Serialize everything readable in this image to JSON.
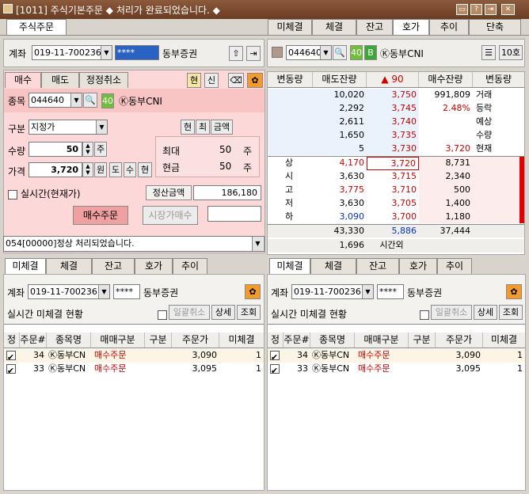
{
  "window": {
    "title": "[1011] 주식기본주문   ◆ 처리가 완료되었습니다. ◆"
  },
  "main_tabs": [
    "주식주문"
  ],
  "top_right_tabs": [
    "미체결",
    "체결",
    "잔고",
    "호가",
    "추이",
    "단축"
  ],
  "account": {
    "label": "계좌",
    "number": "019-11-700236",
    "password": "****",
    "broker": "동부증권"
  },
  "order": {
    "tabs": [
      "매수",
      "매도",
      "정정취소"
    ],
    "toggle_a": "현",
    "toggle_b": "신",
    "stock_label": "종목",
    "stock_code": "044640",
    "stock_badge": "40",
    "stock_name": "Ⓚ동부CNI",
    "type_label": "구분",
    "type_value": "지정가",
    "type_buttons": [
      "현",
      "최",
      "금액"
    ],
    "qty_label": "수량",
    "qty_value": "50",
    "qty_unit": "주",
    "price_label": "가격",
    "price_value": "3,720",
    "price_unit": "원",
    "price_buttons": [
      "도",
      "수",
      "현"
    ],
    "max_label": "최대",
    "max_value": "50",
    "max_unit": "주",
    "cur_label": "현금",
    "cur_value": "50",
    "cur_unit": "주",
    "realtime_label": "실시간(현재가)",
    "settle_label": "정산금액",
    "settle_value": "186,180",
    "buy_button": "매수주문",
    "market_buy_button": "시장가매수",
    "message": "054[00000]정상 처리되었습니다."
  },
  "quote": {
    "code": "044640",
    "badge1": "40",
    "badge2": "B",
    "name": "Ⓚ동부CNI",
    "ticks": "10호",
    "headers": [
      "변동량",
      "매도잔량",
      "▲  90",
      "매수잔량",
      "변동량"
    ],
    "ask_rows": [
      {
        "qty": "10,020",
        "price": "3,750",
        "bid": "991,809",
        "side": "거래"
      },
      {
        "qty": "2,292",
        "price": "3,745",
        "bid": "2.48%",
        "side": "등락"
      },
      {
        "qty": "2,611",
        "price": "3,740",
        "bid": "",
        "side": "예상"
      },
      {
        "qty": "1,650",
        "price": "3,735",
        "bid": "",
        "side": "수량"
      },
      {
        "qty": "5",
        "price": "3,730",
        "bid": "3,720",
        "side": "현재"
      }
    ],
    "bid_rows": [
      {
        "label": "상",
        "ask": "4,170",
        "price": "3,720",
        "bid": "8,731"
      },
      {
        "label": "시",
        "ask": "3,630",
        "price": "3,715",
        "bid": "2,340"
      },
      {
        "label": "고",
        "ask": "3,775",
        "price": "3,710",
        "bid": "500"
      },
      {
        "label": "저",
        "ask": "3,630",
        "price": "3,705",
        "bid": "1,400"
      },
      {
        "label": "하",
        "ask": "3,090",
        "price": "3,700",
        "bid": "1,180"
      }
    ],
    "total_ask": "43,330",
    "total_diff": "5,886",
    "total_bid": "37,444",
    "after_hours_qty": "1,696",
    "after_hours_label": "시간외"
  },
  "bottom_tabs": [
    "미체결",
    "체결",
    "잔고",
    "호가",
    "추이"
  ],
  "unfilled": {
    "title": "실시간 미체결 현황",
    "cancel_all": "일괄취소",
    "detail": "상세",
    "query": "조회",
    "headers": [
      "정",
      "주문#",
      "종목명",
      "매매구분",
      "구분",
      "주문가",
      "미체결"
    ],
    "rows": [
      {
        "no": "34",
        "name": "Ⓚ동부CN",
        "type": "매수주문",
        "kind": "",
        "price": "3,090",
        "left": "1"
      },
      {
        "no": "33",
        "name": "Ⓚ동부CN",
        "type": "매수주문",
        "kind": "",
        "price": "3,095",
        "left": "1"
      }
    ]
  }
}
